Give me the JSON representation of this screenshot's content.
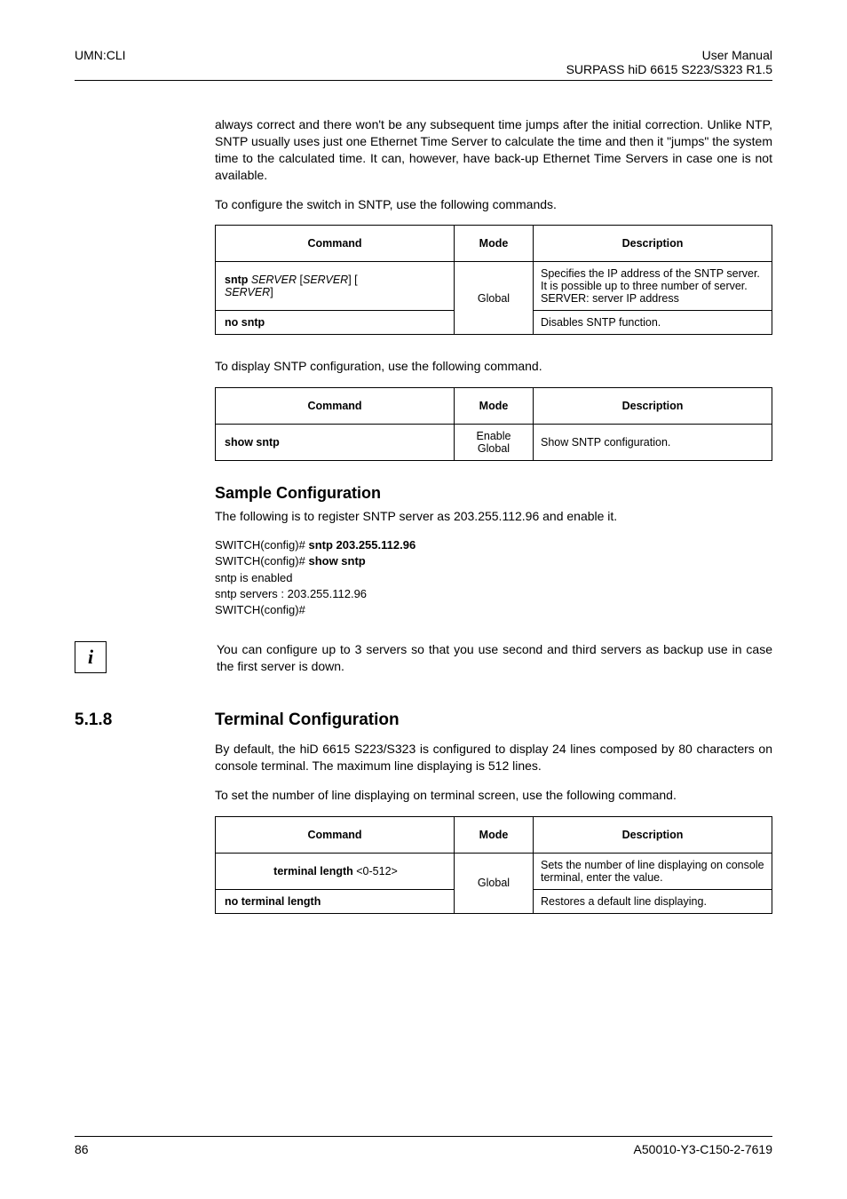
{
  "header": {
    "left": "UMN:CLI",
    "right1": "User  Manual",
    "right2": "SURPASS hiD 6615 S223/S323 R1.5"
  },
  "p1": "always correct and there won't be any subsequent time jumps after the initial correction. Unlike NTP, SNTP usually uses just one Ethernet Time Server to calculate the time and then it \"jumps\" the system time to the calculated time. It can, however, have back-up Ethernet Time Servers in case one is not available.",
  "p2": "To configure the switch in SNTP, use the following commands.",
  "t1": {
    "h1": "Command",
    "h2": "Mode",
    "h3": "Description",
    "r1c1a": "sntp ",
    "r1c1b": "SERVER",
    "r1c1c": " [",
    "r1c1d": "SERVER",
    "r1c1e": "] [",
    "r1c1f": "SERVER",
    "r1c1g": "]",
    "mode": "Global",
    "r1d": "Specifies the IP address of the SNTP server. It is possible up to three number of server.\nSERVER: server IP address",
    "r2c1": "no sntp",
    "r2d": "Disables SNTP function."
  },
  "p3": "To display SNTP configuration, use the following command.",
  "t2": {
    "h1": "Command",
    "h2": "Mode",
    "h3": "Description",
    "r1c1": "show sntp",
    "mode": "Enable\nGlobal",
    "r1d": "Show SNTP configuration."
  },
  "sample": "Sample Configuration",
  "p4": "The following is to register SNTP server as 203.255.112.96 and enable it.",
  "cli": {
    "l1a": "SWITCH(config)# ",
    "l1b": "sntp 203.255.112.96",
    "l2a": "SWITCH(config)# ",
    "l2b": "show sntp",
    "l3": "sntp is enabled",
    "l4": "sntp servers : 203.255.112.96",
    "l5": "SWITCH(config)#"
  },
  "info": {
    "icon": "i",
    "text": "You can configure up to 3 servers so that you use second and third servers as backup use in case the first server is down."
  },
  "sec": {
    "num": "5.1.8",
    "title": "Terminal Configuration"
  },
  "p5": "By default, the hiD 6615 S223/S323 is configured to display 24 lines composed by 80 characters on console terminal. The maximum line displaying is 512 lines.",
  "p6": "To set the number of line displaying on terminal screen, use the following command.",
  "t3": {
    "h1": "Command",
    "h2": "Mode",
    "h3": "Description",
    "r1c1a": "terminal length ",
    "r1c1b": "<0-512>",
    "mode": "Global",
    "r1d": "Sets the number of line displaying on console terminal, enter the value.",
    "r2c1": "no terminal length",
    "r2d": "Restores a default line displaying."
  },
  "footer": {
    "left": "86",
    "right": "A50010-Y3-C150-2-7619"
  }
}
